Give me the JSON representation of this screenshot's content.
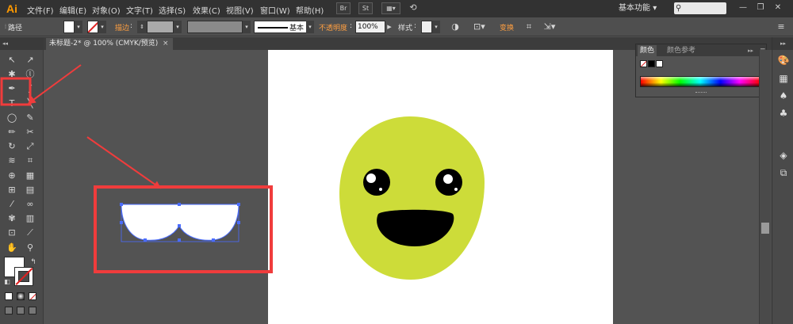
{
  "app": {
    "logo": "Ai",
    "menu": [
      "文件(F)",
      "编辑(E)",
      "对象(O)",
      "文字(T)",
      "选择(S)",
      "效果(C)",
      "视图(V)",
      "窗口(W)",
      "帮助(H)"
    ],
    "br_label": "Br",
    "st_label": "St",
    "workspace": "基本功能",
    "workspace_arrow": "▾",
    "search_icon": "search-icon",
    "minimize": "—",
    "maximize": "❐",
    "close": "✕"
  },
  "control_bar": {
    "selection_type": "路径",
    "stroke_label": "描边",
    "stroke_style_label": "基本",
    "opacity_label": "不透明度",
    "opacity_value": "100%",
    "style_label": "样式",
    "transform_label": "变换",
    "colors": {
      "fill": "#ffffff",
      "stroke": "none"
    }
  },
  "document_tab": {
    "title": "未标题-2* @ 100% (CMYK/预览)",
    "close": "×"
  },
  "color_panel": {
    "tabs": [
      "颜色",
      "颜色参考"
    ],
    "menu": "≡",
    "collapse": "▸▸"
  },
  "tools": [
    {
      "name": "selection-tool-icon",
      "glyph": "↖"
    },
    {
      "name": "direct-selection-tool-icon",
      "glyph": "↗"
    },
    {
      "name": "magic-wand-tool-icon",
      "glyph": "✱"
    },
    {
      "name": "lasso-tool-icon",
      "glyph": "ⓛ"
    },
    {
      "name": "pen-tool-icon",
      "glyph": "✒"
    },
    {
      "name": "curvature-tool-icon",
      "glyph": "∫"
    },
    {
      "name": "type-tool-icon",
      "glyph": "T"
    },
    {
      "name": "line-tool-icon",
      "glyph": "╲"
    },
    {
      "name": "ellipse-tool-icon",
      "glyph": "◯"
    },
    {
      "name": "paintbrush-tool-icon",
      "glyph": "✎"
    },
    {
      "name": "pencil-tool-icon",
      "glyph": "✏"
    },
    {
      "name": "scissors-tool-icon",
      "glyph": "✂"
    },
    {
      "name": "rotate-tool-icon",
      "glyph": "↻"
    },
    {
      "name": "scale-tool-icon",
      "glyph": "⤢"
    },
    {
      "name": "warp-tool-icon",
      "glyph": "≋"
    },
    {
      "name": "free-transform-tool-icon",
      "glyph": "⌗"
    },
    {
      "name": "shape-builder-tool-icon",
      "glyph": "⊕"
    },
    {
      "name": "perspective-grid-tool-icon",
      "glyph": "▦"
    },
    {
      "name": "mesh-tool-icon",
      "glyph": "⊞"
    },
    {
      "name": "gradient-tool-icon",
      "glyph": "▤"
    },
    {
      "name": "eyedropper-tool-icon",
      "glyph": "⁄"
    },
    {
      "name": "blend-tool-icon",
      "glyph": "∞"
    },
    {
      "name": "symbol-sprayer-tool-icon",
      "glyph": "✾"
    },
    {
      "name": "column-graph-tool-icon",
      "glyph": "▥"
    },
    {
      "name": "artboard-tool-icon",
      "glyph": "⊡"
    },
    {
      "name": "slice-tool-icon",
      "glyph": "⟋"
    },
    {
      "name": "hand-tool-icon",
      "glyph": "✋"
    },
    {
      "name": "zoom-tool-icon",
      "glyph": "⚲"
    }
  ],
  "dock": [
    {
      "name": "color-guide-panel-icon",
      "glyph": "🎨"
    },
    {
      "name": "swatches-panel-icon",
      "glyph": "▦"
    },
    {
      "name": "brushes-panel-icon",
      "glyph": "♠"
    },
    {
      "name": "symbols-panel-icon",
      "glyph": "♣"
    },
    {
      "name": "layers-panel-icon",
      "glyph": "◈"
    },
    {
      "name": "artboards-panel-icon",
      "glyph": "⧉"
    }
  ],
  "artwork": {
    "face_color": "#cddc39",
    "eye_color": "#000000",
    "highlight_color": "#ffffff",
    "mouth_color": "#000000",
    "selection_color": "#4a6cff",
    "annotation_color": "#f03c3c"
  }
}
